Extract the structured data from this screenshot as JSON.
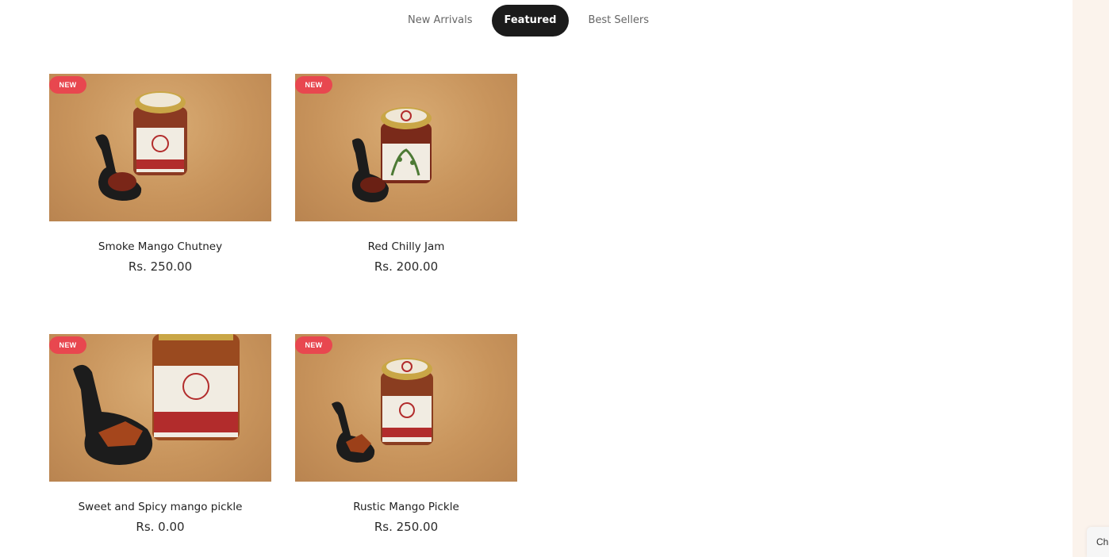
{
  "tabs": [
    {
      "label": "New Arrivals",
      "active": false
    },
    {
      "label": "Featured",
      "active": true
    },
    {
      "label": "Best Sellers",
      "active": false
    }
  ],
  "products": [
    {
      "badge": "NEW",
      "title": "Smoke Mango Chutney",
      "price": "Rs. 250.00",
      "image_icon": "mango-chutney-jar-image"
    },
    {
      "badge": "NEW",
      "title": "Red Chilly Jam",
      "price": "Rs. 200.00",
      "image_icon": "chilly-jam-jar-image"
    },
    {
      "badge": "NEW",
      "title": "Sweet and Spicy mango pickle",
      "price": "Rs. 0.00",
      "image_icon": "mango-pickle-jar-image"
    },
    {
      "badge": "NEW",
      "title": "Rustic Mango Pickle",
      "price": "Rs. 250.00",
      "image_icon": "rustic-pickle-jar-image"
    }
  ],
  "chat": {
    "label": "Cha"
  },
  "colors": {
    "badge": "#e8474f",
    "active_tab": "#1b1b1b",
    "side_panel": "#fbf3ec"
  }
}
